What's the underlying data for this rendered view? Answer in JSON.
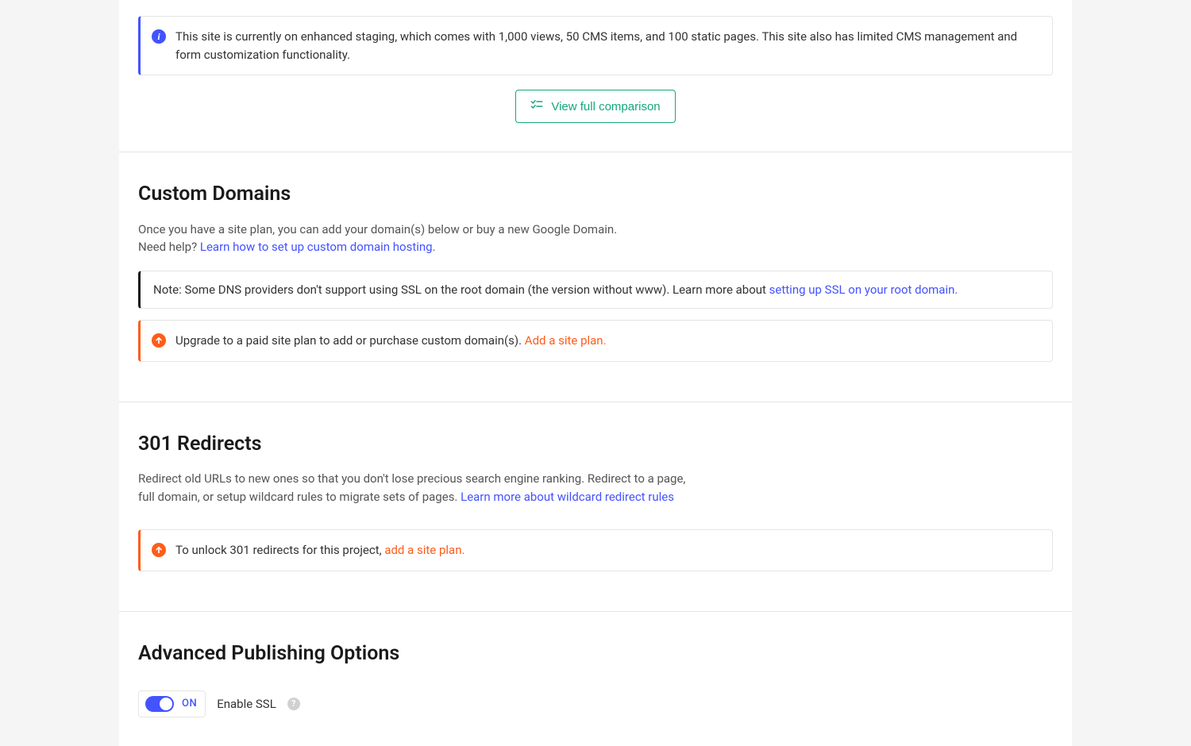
{
  "staging_alert": {
    "text": "This site is currently on enhanced staging, which comes with 1,000 views, 50 CMS items, and 100 static pages. This site also has limited CMS management and form customization functionality."
  },
  "compare_button": {
    "label": "View full comparison"
  },
  "custom_domains": {
    "title": "Custom Domains",
    "desc_line1": "Once you have a site plan, you can add your domain(s) below or buy a new Google Domain.",
    "desc_line2_pre": "Need help? ",
    "desc_line2_link": "Learn how to set up custom domain hosting",
    "desc_line2_post": ".",
    "ssl_note_pre": "Note: Some DNS providers don't support using SSL on the root domain (the version without www). Learn more about ",
    "ssl_note_link": "setting up SSL on your root domain.",
    "upgrade_pre": "Upgrade to a paid site plan to add or purchase custom domain(s). ",
    "upgrade_link": "Add a site plan."
  },
  "redirects": {
    "title": "301 Redirects",
    "desc_pre": "Redirect old URLs to new ones so that you don't lose precious search engine ranking. Redirect to a page, full domain, or setup wildcard rules to migrate sets of pages. ",
    "desc_link": "Learn more about wildcard redirect rules",
    "unlock_pre": "To unlock 301 redirects for this project, ",
    "unlock_link": "add a site plan."
  },
  "advanced": {
    "title": "Advanced Publishing Options",
    "ssl_toggle_state": "ON",
    "ssl_label": "Enable SSL"
  }
}
